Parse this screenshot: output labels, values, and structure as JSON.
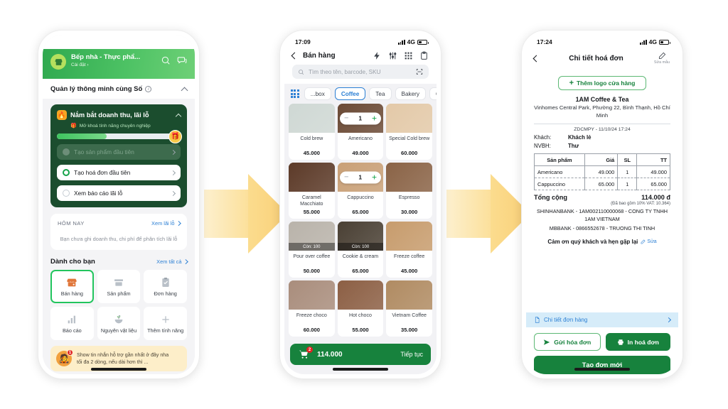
{
  "phone1": {
    "status": {
      "time": "",
      "network": ""
    },
    "header": {
      "shop_name": "Bếp nhà - Thực phẩ...",
      "settings_link": "Cài đặt  ›",
      "logo_icon": "store-icon",
      "search_icon": "search-icon",
      "chat_icon": "chat-icon"
    },
    "section": {
      "title": "Quản lý thông minh cùng Số",
      "info_icon": "info-icon",
      "collapse_icon": "chevron-up-icon"
    },
    "promo_card": {
      "title": "Nắm bắt doanh thu, lãi lỗ",
      "icon": "flame-icon",
      "collapse_icon": "chevron-up-icon",
      "unlock_icon": "gift-icon",
      "unlock_text": "Mở khoá tính năng chuyên nghiệp",
      "progress_percent": 40,
      "gift_icon": "gift-box-icon",
      "steps": [
        {
          "label": "Tạo sản phẩm đầu tiên",
          "state": "done"
        },
        {
          "label": "Tạo hoá đơn đầu tiên",
          "state": "current"
        },
        {
          "label": "Xem báo cáo lãi lỗ",
          "state": "todo"
        }
      ]
    },
    "today": {
      "label": "HÔM NAY",
      "link": "Xem lãi lỗ",
      "message": "Bạn chưa ghi doanh thu, chi phí để phân tích lãi lỗ"
    },
    "foryou": {
      "title": "Dành cho bạn",
      "link": "Xem tất cả",
      "tiles": [
        {
          "label": "Bán hàng",
          "icon": "store-front-icon",
          "active": true
        },
        {
          "label": "Sản phẩm",
          "icon": "box-icon",
          "active": false
        },
        {
          "label": "Đơn hàng",
          "icon": "clipboard-check-icon",
          "active": false
        },
        {
          "label": "Báo cáo",
          "icon": "bar-chart-icon",
          "active": false
        },
        {
          "label": "Nguyên vật liệu",
          "icon": "ingredients-icon",
          "active": false
        },
        {
          "label": "Thêm tính năng",
          "icon": "plus-icon",
          "active": false
        }
      ]
    },
    "support": {
      "avatar_icon": "agent-avatar",
      "badge": "1",
      "line1": "Show tin nhắn hỗ trợ gần nhất ở đây nha",
      "line2": "tối đa 2 dòng, nếu dài hơn thì ..."
    }
  },
  "phone2": {
    "status": {
      "time": "17:09",
      "network": "4G"
    },
    "nav": {
      "title": "Bán hàng",
      "back_icon": "chevron-left-icon",
      "icons": [
        "flash-icon",
        "sliders-icon",
        "keypad-icon",
        "clipboard-icon"
      ]
    },
    "search": {
      "placeholder": "Tìm theo tên, barcode, SKU",
      "search_icon": "search-icon",
      "scan_icon": "scan-icon"
    },
    "categories": [
      {
        "label": "...box",
        "active": false
      },
      {
        "label": "Coffee",
        "active": true
      },
      {
        "label": "Tea",
        "active": false
      },
      {
        "label": "Bakery",
        "active": false
      },
      {
        "label": "Cookie",
        "active": false
      }
    ],
    "grid_icon": "grid-icon",
    "products": [
      {
        "name": "Cold brew",
        "price": "45.000",
        "qty": null,
        "stock": null,
        "img": "#cfd8d4"
      },
      {
        "name": "Americano",
        "price": "49.000",
        "qty": "1",
        "stock": null,
        "img": "#6b4a35"
      },
      {
        "name": "Special Cold brew",
        "price": "60.000",
        "qty": null,
        "stock": null,
        "img": "#e3c9a8"
      },
      {
        "name": "Caramel Macchiato",
        "price": "55.000",
        "qty": null,
        "stock": null,
        "img": "#5c3a28"
      },
      {
        "name": "Cappuccino",
        "price": "65.000",
        "qty": "1",
        "stock": null,
        "img": "#c9a077"
      },
      {
        "name": "Espresso",
        "price": "30.000",
        "qty": null,
        "stock": null,
        "img": "#8a6346"
      },
      {
        "name": "Pour over coffee",
        "price": "50.000",
        "qty": null,
        "stock": "Còn: 100",
        "img": "#b9b3aa"
      },
      {
        "name": "Cookie & cream",
        "price": "65.000",
        "qty": null,
        "stock": "Còn: 100",
        "img": "#4a4034"
      },
      {
        "name": "Freeze coffee",
        "price": "45.000",
        "qty": null,
        "stock": null,
        "img": "#c79c6d"
      },
      {
        "name": "Freeze choco",
        "price": "60.000",
        "qty": null,
        "stock": null,
        "img": "#a98d7c"
      },
      {
        "name": "Hot choco",
        "price": "55.000",
        "qty": null,
        "stock": null,
        "img": "#8c5f44"
      },
      {
        "name": "Vietnam Coffee",
        "price": "35.000",
        "qty": null,
        "stock": null,
        "img": "#b08b62"
      }
    ],
    "cart": {
      "total": "114.000",
      "cta": "Tiếp tục",
      "badge": "2",
      "cart_icon": "cart-icon"
    }
  },
  "phone3": {
    "status": {
      "time": "17:24",
      "network": "4G"
    },
    "nav": {
      "title": "Chi tiết hoá đơn",
      "back_icon": "chevron-left-icon",
      "edit_icon": "pencil-icon",
      "edit_label": "Sửa mẫu"
    },
    "logo_button": {
      "label": "Thêm logo cửa hàng",
      "icon": "plus-icon"
    },
    "invoice": {
      "shop": "1AM Coffee & Tea",
      "address": "Vinhomes Central Park, Phường 22, Bình Thạnh, Hồ Chí Minh",
      "code": "ZDCMPY  -  11/10/24 17:24",
      "customer_label": "Khách:",
      "customer_value": "Khách lẻ",
      "staff_label": "NVBH:",
      "staff_value": "Thư",
      "columns": [
        "Sản phẩm",
        "Giá",
        "SL",
        "TT"
      ],
      "rows": [
        {
          "name": "Americano",
          "price": "49.000",
          "qty": "1",
          "total": "49.000"
        },
        {
          "name": "Cappuccino",
          "price": "65.000",
          "qty": "1",
          "total": "65.000"
        }
      ],
      "total_label": "Tổng cộng",
      "total_value": "114.000 đ",
      "vat_note": "(Đã bao gồm 10% VAT: 10.364)",
      "bank1": "SHINHANBANK - 1AM002110000068 - CONG TY TNHH 1AM VIETNAM",
      "bank2": "MBBANK - 0866552678 - TRUONG THI TINH",
      "thanks": "Cảm ơn quý khách và hẹn gặp lại",
      "thanks_edit": "Sửa",
      "thanks_edit_icon": "pencil-icon"
    },
    "order_link": {
      "label": "Chi tiết đơn hàng",
      "icon": "document-icon",
      "chevron": "chevron-right-icon"
    },
    "actions": {
      "send": {
        "label": "Gửi hóa đơn",
        "icon": "send-icon"
      },
      "print": {
        "label": "In hoá đơn",
        "icon": "printer-icon"
      },
      "new": {
        "label": "Tạo đơn mới"
      }
    }
  },
  "arrows": {
    "count": 2,
    "color": "#fbdc8e"
  }
}
